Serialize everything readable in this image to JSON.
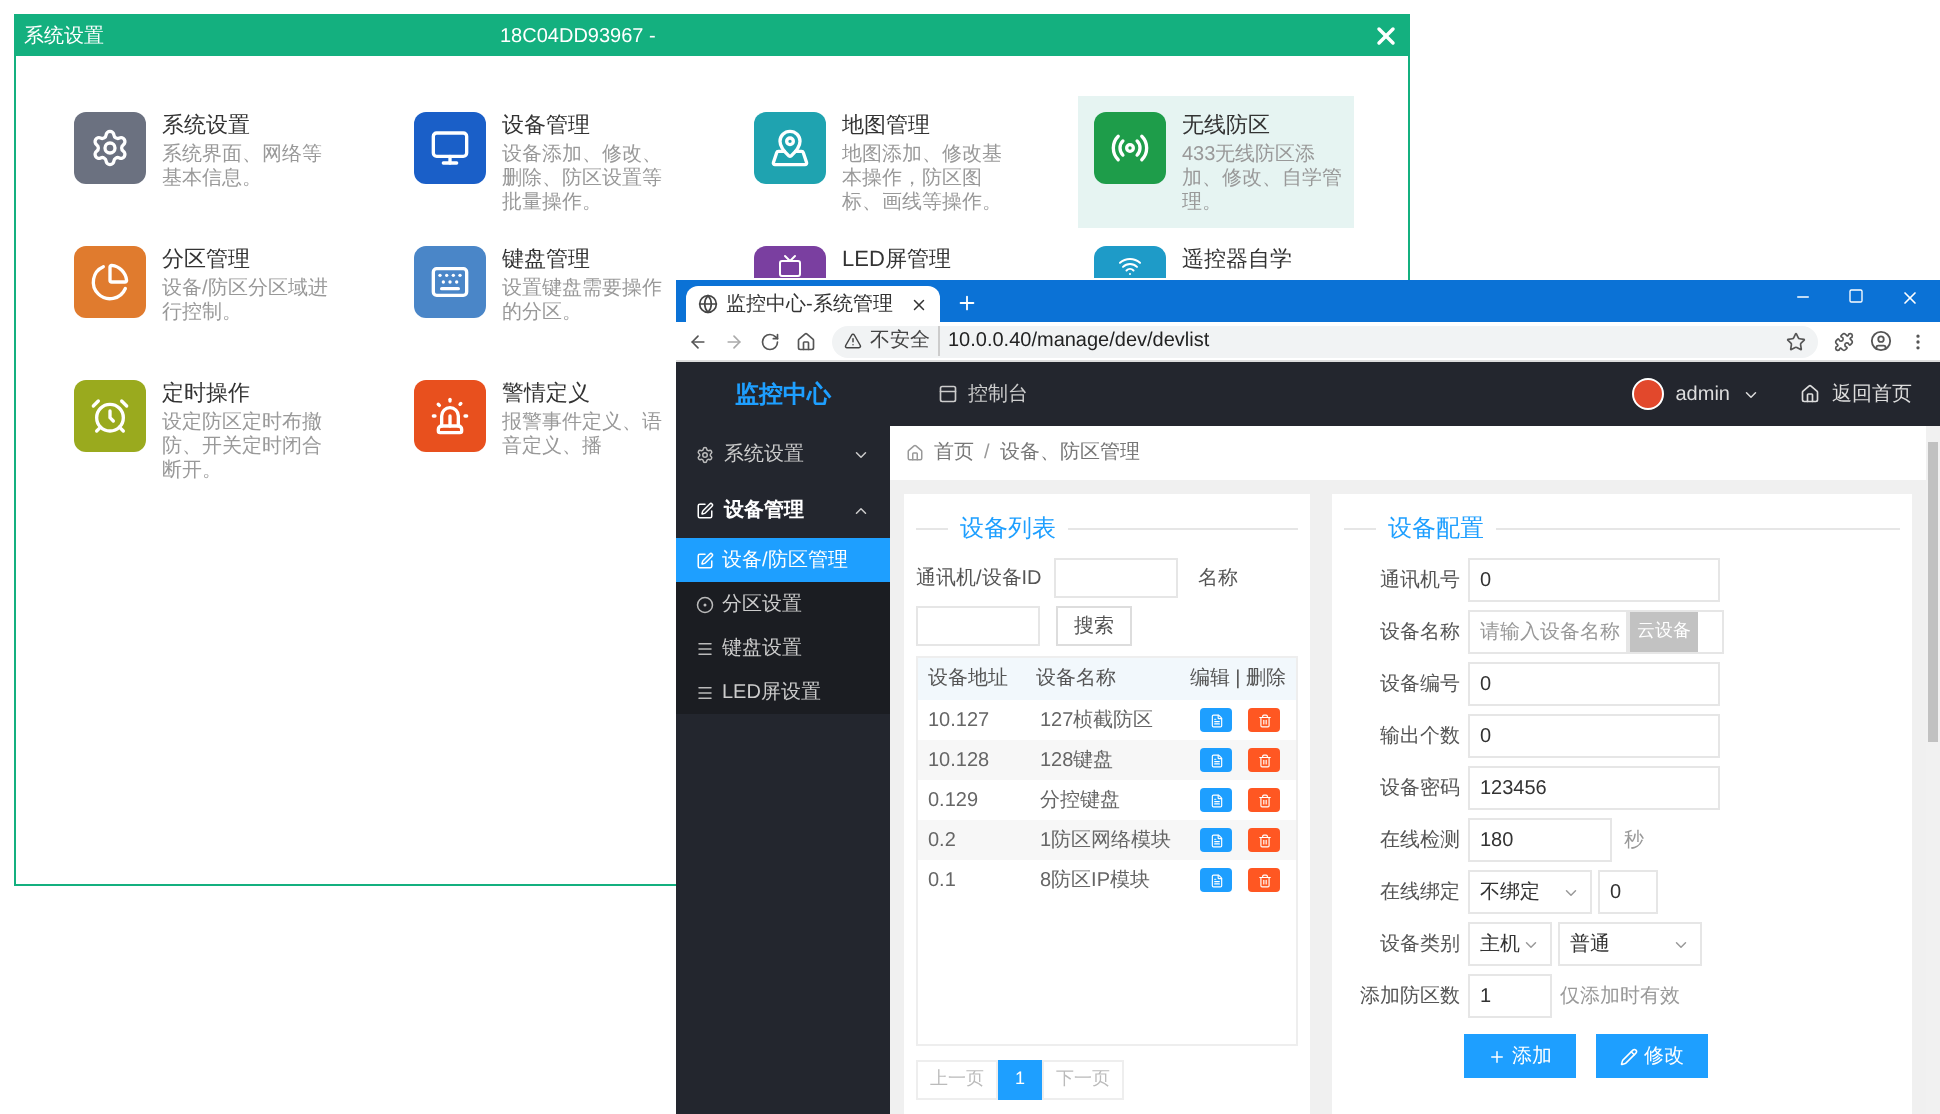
{
  "settings_window": {
    "title": "系统设置",
    "device_id": "18C04DD93967 -",
    "tiles": [
      {
        "title": "系统设置",
        "description": "系统界面、网络等基本信息。",
        "color": "#6b7180",
        "selected": false
      },
      {
        "title": "设备管理",
        "description": "设备添加、修改、删除、防区设置等批量操作。",
        "color": "#1a5fc8",
        "selected": false
      },
      {
        "title": "地图管理",
        "description": "地图添加、修改基本操作，防区图标、画线等操作。",
        "color": "#1fa3b0",
        "selected": false
      },
      {
        "title": "无线防区",
        "description": "433无线防区添加、修改、自学管理。",
        "color": "#1e9d4a",
        "selected": true
      },
      {
        "title": "分区管理",
        "description": "设备/防区分区域进行控制。",
        "color": "#e07b2e",
        "selected": false
      },
      {
        "title": "键盘管理",
        "description": "设置键盘需要操作的分区。",
        "color": "#4a86c8",
        "selected": false
      },
      {
        "title": "LED屏管理",
        "color": "#7a3fa0",
        "selected": false
      },
      {
        "title": "遥控器自学",
        "color": "#1e9bc8",
        "selected": false
      },
      {
        "title": "定时操作",
        "description": "设定防区定时布撤防、开关定时闭合断开。",
        "color": "#9aaa1e",
        "selected": false
      },
      {
        "title": "警情定义",
        "description": "报警事件定义、语音定义、播",
        "color": "#e8501e",
        "selected": false
      }
    ]
  },
  "browser": {
    "tab_title": "监控中心-系统管理",
    "security": "不安全",
    "url": "10.0.0.40/manage/dev/devlist"
  },
  "app": {
    "brand": "监控中心",
    "nav": "控制台",
    "user": "admin",
    "home_link": "返回首页",
    "sidebar": [
      {
        "label": "系统设置",
        "expanded": false
      },
      {
        "label": "设备管理",
        "expanded": true,
        "children": [
          {
            "label": "设备/防区管理",
            "selected": true
          },
          {
            "label": "分区设置",
            "selected": false
          },
          {
            "label": "键盘设置",
            "selected": false
          },
          {
            "label": "LED屏设置",
            "selected": false
          }
        ]
      }
    ],
    "breadcrumb": {
      "items": [
        "首页",
        "设备、防区管理"
      ],
      "separator": "/"
    },
    "device_list": {
      "title": "设备列表",
      "id_label": "通讯机/设备ID",
      "name_label": "名称",
      "search_button": "搜索",
      "columns": [
        "设备地址",
        "设备名称",
        "编辑 | 删除"
      ],
      "rows": [
        {
          "address": "10.127",
          "name": "127桢截防区"
        },
        {
          "address": "10.128",
          "name": "128键盘"
        },
        {
          "address": "0.129",
          "name": "分控键盘"
        },
        {
          "address": "0.2",
          "name": "1防区网络模块"
        },
        {
          "address": "0.1",
          "name": "8防区IP模块"
        }
      ],
      "pagination": {
        "prev": "上一页",
        "page": "1",
        "next": "下一页"
      }
    },
    "device_config": {
      "title": "设备配置",
      "fields": [
        {
          "kind": "text",
          "label": "通讯机号",
          "value": "0"
        },
        {
          "kind": "toggle",
          "label": "设备名称",
          "placeholder": "请输入设备名称",
          "toggle_label": "云设备",
          "on": false
        },
        {
          "kind": "text",
          "label": "设备编号",
          "value": "0"
        },
        {
          "kind": "text",
          "label": "输出个数",
          "value": "0"
        },
        {
          "kind": "text",
          "label": "设备密码",
          "value": "123456"
        },
        {
          "kind": "suffix",
          "label": "在线检测",
          "value": "180",
          "suffix": "秒"
        },
        {
          "kind": "select_text",
          "label": "在线绑定",
          "select": "不绑定",
          "value": "0"
        },
        {
          "kind": "two_selects",
          "label": "设备类别",
          "select": "主机",
          "select2": "普通"
        },
        {
          "kind": "hint",
          "label": "添加防区数",
          "value": "1",
          "hint": "仅添加时有效"
        }
      ],
      "buttons": [
        {
          "kind": "add",
          "label": "添加"
        },
        {
          "kind": "edit",
          "label": "修改"
        }
      ]
    }
  }
}
